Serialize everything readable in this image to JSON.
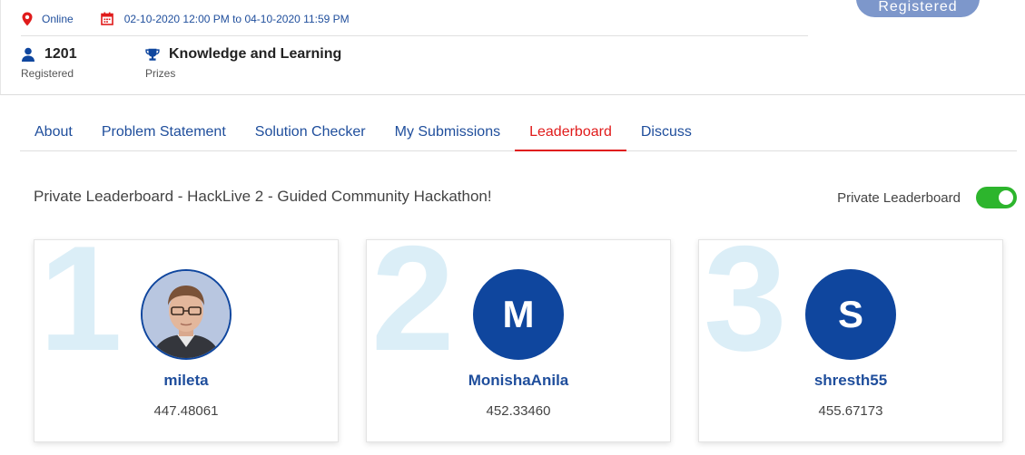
{
  "event": {
    "location": "Online",
    "date_range": "02-10-2020 12:00 PM to 04-10-2020 11:59 PM",
    "register_button": "Registered"
  },
  "stats": {
    "registered_value": "1201",
    "registered_label": "Registered",
    "prizes_value": "Knowledge and Learning",
    "prizes_label": "Prizes"
  },
  "tabs": [
    {
      "label": "About",
      "active": false
    },
    {
      "label": "Problem Statement",
      "active": false
    },
    {
      "label": "Solution Checker",
      "active": false
    },
    {
      "label": "My Submissions",
      "active": false
    },
    {
      "label": "Leaderboard",
      "active": true
    },
    {
      "label": "Discuss",
      "active": false
    }
  ],
  "leaderboard": {
    "title": "Private Leaderboard - HackLive 2 - Guided Community Hackathon!",
    "toggle_label": "Private Leaderboard",
    "toggle_on": true,
    "entries": [
      {
        "rank": "1",
        "name": "mileta",
        "score": "447.48061",
        "avatar_initial": "",
        "avatar_type": "photo"
      },
      {
        "rank": "2",
        "name": "MonishaAnila",
        "score": "452.33460",
        "avatar_initial": "M",
        "avatar_type": "initial"
      },
      {
        "rank": "3",
        "name": "shresth55",
        "score": "455.67173",
        "avatar_initial": "S",
        "avatar_type": "initial"
      }
    ]
  },
  "colors": {
    "brand_blue": "#1f4e9c",
    "active_red": "#e01b1b",
    "toggle_green": "#2db52d",
    "rank_watermark": "#dbeef7",
    "avatar_blue": "#0f469e"
  },
  "icons": {
    "location": "map-pin-icon",
    "calendar": "calendar-icon",
    "registered": "user-icon",
    "prizes": "trophy-icon"
  }
}
